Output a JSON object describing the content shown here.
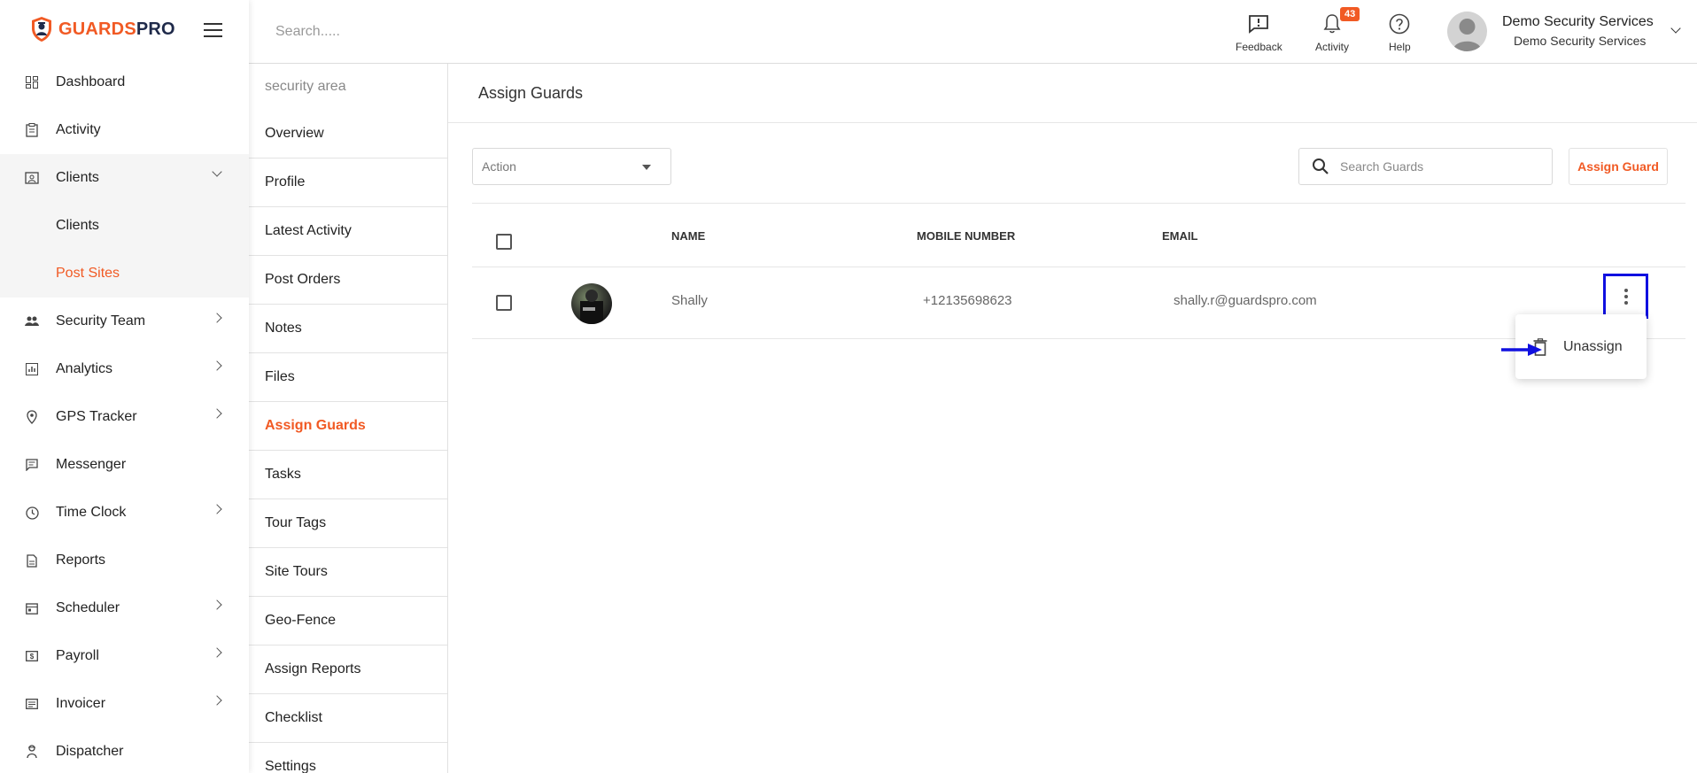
{
  "brand": {
    "part1": "GUARDS",
    "part2": "PRO"
  },
  "sidebar": {
    "items": [
      {
        "label": "Dashboard",
        "icon": "dashboard-icon"
      },
      {
        "label": "Activity",
        "icon": "clipboard-icon"
      },
      {
        "label": "Clients",
        "icon": "contact-icon",
        "expanded": true,
        "children": [
          {
            "label": "Clients"
          },
          {
            "label": "Post Sites",
            "active": true
          }
        ]
      },
      {
        "label": "Security Team",
        "icon": "people-icon",
        "chevron": true
      },
      {
        "label": "Analytics",
        "icon": "chart-icon",
        "chevron": true
      },
      {
        "label": "GPS Tracker",
        "icon": "location-pin-icon",
        "chevron": true
      },
      {
        "label": "Messenger",
        "icon": "message-icon"
      },
      {
        "label": "Time Clock",
        "icon": "clock-icon",
        "chevron": true
      },
      {
        "label": "Reports",
        "icon": "report-icon"
      },
      {
        "label": "Scheduler",
        "icon": "calendar-icon",
        "chevron": true
      },
      {
        "label": "Payroll",
        "icon": "dollar-icon",
        "chevron": true
      },
      {
        "label": "Invoicer",
        "icon": "invoice-icon",
        "chevron": true
      },
      {
        "label": "Dispatcher",
        "icon": "dispatcher-icon"
      }
    ]
  },
  "topbar": {
    "search_placeholder": "Search.....",
    "feedback_label": "Feedback",
    "activity_label": "Activity",
    "activity_count": "43",
    "help_label": "Help",
    "user_name": "Demo Security Services",
    "user_company": "Demo Security Services"
  },
  "site_menu": {
    "header": "security area",
    "items": [
      "Overview",
      "Profile",
      "Latest Activity",
      "Post Orders",
      "Notes",
      "Files",
      "Assign Guards",
      "Tasks",
      "Tour Tags",
      "Site Tours",
      "Geo-Fence",
      "Assign Reports",
      "Checklist",
      "Settings"
    ],
    "active": "Assign Guards"
  },
  "main": {
    "title": "Assign Guards",
    "action_placeholder": "Action",
    "search_placeholder": "Search Guards",
    "assign_button": "Assign Guard",
    "columns": {
      "name": "NAME",
      "mobile": "MOBILE NUMBER",
      "email": "EMAIL"
    },
    "rows": [
      {
        "name": "Shally",
        "mobile": "+12135698623",
        "email": "shally.r@guardspro.com"
      }
    ]
  },
  "row_menu": {
    "unassign_label": "Unassign"
  },
  "colors": {
    "accent": "#f15a24",
    "highlight": "#1010e0"
  }
}
